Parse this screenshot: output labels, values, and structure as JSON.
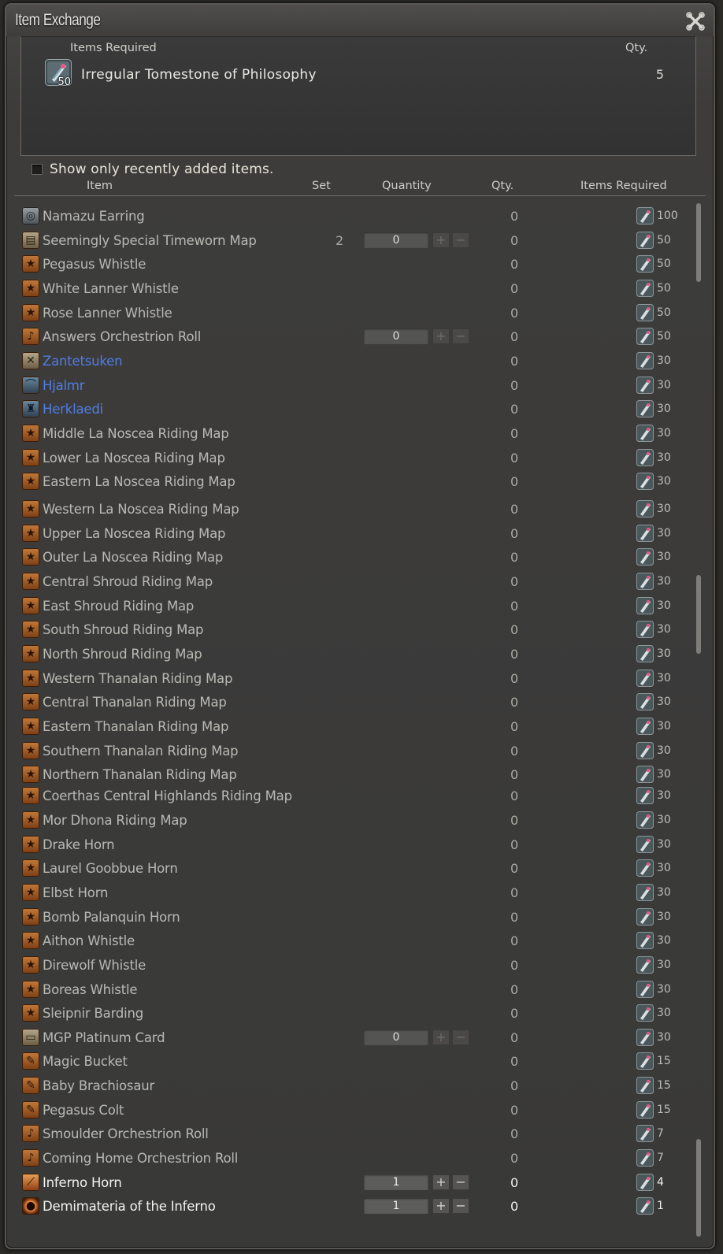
{
  "window": {
    "title": "Item Exchange"
  },
  "required_panel": {
    "header_item": "Items Required",
    "header_qty": "Qty.",
    "item_name": "Irregular Tomestone of Philosophy",
    "item_count_badge": "50",
    "item_qty": "5"
  },
  "filter": {
    "label": "Show only recently added items.",
    "checked": false
  },
  "columns": {
    "item": "Item",
    "set": "Set",
    "quantity": "Quantity",
    "qty": "Qty.",
    "items_required": "Items Required"
  },
  "rows": [
    {
      "name": "Namazu Earring",
      "icon": "earring-icon",
      "style": "gray",
      "set": "",
      "stepper": "",
      "qty": "0",
      "req": "100"
    },
    {
      "name": "Seemingly Special Timeworn Map",
      "icon": "map-icon",
      "style": "tan",
      "set": "2",
      "stepper": "0",
      "qty": "0",
      "req": "50"
    },
    {
      "name": "Pegasus Whistle",
      "icon": "star-icon",
      "style": "",
      "set": "",
      "stepper": "",
      "qty": "0",
      "req": "50"
    },
    {
      "name": "White Lanner Whistle",
      "icon": "star-icon",
      "style": "",
      "set": "",
      "stepper": "",
      "qty": "0",
      "req": "50"
    },
    {
      "name": "Rose Lanner Whistle",
      "icon": "star-icon",
      "style": "",
      "set": "",
      "stepper": "",
      "qty": "0",
      "req": "50"
    },
    {
      "name": "Answers Orchestrion Roll",
      "icon": "music-note-icon",
      "style": "",
      "set": "",
      "stepper": "0",
      "qty": "0",
      "req": "50"
    },
    {
      "name": "Zantetsuken",
      "icon": "crossed-swords-icon",
      "style": "tan",
      "set": "",
      "stepper": "",
      "qty": "0",
      "req": "30",
      "link": true
    },
    {
      "name": "Hjalmr",
      "icon": "helmet-icon",
      "style": "blue",
      "set": "",
      "stepper": "",
      "qty": "0",
      "req": "30",
      "link": true
    },
    {
      "name": "Herklaedi",
      "icon": "armor-icon",
      "style": "blue",
      "set": "",
      "stepper": "",
      "qty": "0",
      "req": "30",
      "link": true
    },
    {
      "name": "Middle La Noscea Riding Map",
      "icon": "star-icon",
      "style": "",
      "set": "",
      "stepper": "",
      "qty": "0",
      "req": "30"
    },
    {
      "name": "Lower La Noscea Riding Map",
      "icon": "star-icon",
      "style": "",
      "set": "",
      "stepper": "",
      "qty": "0",
      "req": "30"
    },
    {
      "name": "Eastern La Noscea Riding Map",
      "icon": "star-icon",
      "style": "",
      "set": "",
      "stepper": "",
      "qty": "0",
      "req": "30"
    },
    {
      "name": "Western La Noscea Riding Map",
      "icon": "star-icon",
      "style": "",
      "set": "",
      "stepper": "",
      "qty": "0",
      "req": "30"
    },
    {
      "name": "Upper La Noscea Riding Map",
      "icon": "star-icon",
      "style": "",
      "set": "",
      "stepper": "",
      "qty": "0",
      "req": "30"
    },
    {
      "name": "Outer La Noscea Riding Map",
      "icon": "star-icon",
      "style": "",
      "set": "",
      "stepper": "",
      "qty": "0",
      "req": "30"
    },
    {
      "name": "Central Shroud Riding Map",
      "icon": "star-icon",
      "style": "",
      "set": "",
      "stepper": "",
      "qty": "0",
      "req": "30"
    },
    {
      "name": "East Shroud Riding Map",
      "icon": "star-icon",
      "style": "",
      "set": "",
      "stepper": "",
      "qty": "0",
      "req": "30"
    },
    {
      "name": "South Shroud Riding Map",
      "icon": "star-icon",
      "style": "",
      "set": "",
      "stepper": "",
      "qty": "0",
      "req": "30"
    },
    {
      "name": "North Shroud Riding Map",
      "icon": "star-icon",
      "style": "",
      "set": "",
      "stepper": "",
      "qty": "0",
      "req": "30"
    },
    {
      "name": "Western Thanalan Riding Map",
      "icon": "star-icon",
      "style": "",
      "set": "",
      "stepper": "",
      "qty": "0",
      "req": "30"
    },
    {
      "name": "Central Thanalan Riding Map",
      "icon": "star-icon",
      "style": "",
      "set": "",
      "stepper": "",
      "qty": "0",
      "req": "30"
    },
    {
      "name": "Eastern Thanalan Riding Map",
      "icon": "star-icon",
      "style": "",
      "set": "",
      "stepper": "",
      "qty": "0",
      "req": "30"
    },
    {
      "name": "Southern Thanalan Riding Map",
      "icon": "star-icon",
      "style": "",
      "set": "",
      "stepper": "",
      "qty": "0",
      "req": "30"
    },
    {
      "name": "Northern Thanalan Riding Map",
      "icon": "star-icon",
      "style": "",
      "set": "",
      "stepper": "",
      "qty": "0",
      "req": "30"
    },
    {
      "name": "Coerthas Central Highlands Riding Map",
      "icon": "star-icon",
      "style": "",
      "set": "",
      "stepper": "",
      "qty": "0",
      "req": "30"
    },
    {
      "name": "Mor Dhona Riding Map",
      "icon": "star-icon",
      "style": "",
      "set": "",
      "stepper": "",
      "qty": "0",
      "req": "30"
    },
    {
      "name": "Drake Horn",
      "icon": "star-icon",
      "style": "",
      "set": "",
      "stepper": "",
      "qty": "0",
      "req": "30"
    },
    {
      "name": "Laurel Goobbue Horn",
      "icon": "star-icon",
      "style": "",
      "set": "",
      "stepper": "",
      "qty": "0",
      "req": "30"
    },
    {
      "name": "Elbst Horn",
      "icon": "star-icon",
      "style": "",
      "set": "",
      "stepper": "",
      "qty": "0",
      "req": "30"
    },
    {
      "name": "Bomb Palanquin Horn",
      "icon": "star-icon",
      "style": "",
      "set": "",
      "stepper": "",
      "qty": "0",
      "req": "30"
    },
    {
      "name": "Aithon Whistle",
      "icon": "star-icon",
      "style": "",
      "set": "",
      "stepper": "",
      "qty": "0",
      "req": "30"
    },
    {
      "name": "Direwolf Whistle",
      "icon": "star-icon",
      "style": "",
      "set": "",
      "stepper": "",
      "qty": "0",
      "req": "30"
    },
    {
      "name": "Boreas Whistle",
      "icon": "star-icon",
      "style": "",
      "set": "",
      "stepper": "",
      "qty": "0",
      "req": "30"
    },
    {
      "name": "Sleipnir Barding",
      "icon": "star-icon",
      "style": "",
      "set": "",
      "stepper": "",
      "qty": "0",
      "req": "30"
    },
    {
      "name": "MGP Platinum Card",
      "icon": "card-icon",
      "style": "tan",
      "set": "",
      "stepper": "0",
      "qty": "0",
      "req": "30"
    },
    {
      "name": "Magic Bucket",
      "icon": "minion-icon",
      "style": "",
      "set": "",
      "stepper": "",
      "qty": "0",
      "req": "15"
    },
    {
      "name": "Baby Brachiosaur",
      "icon": "minion-icon",
      "style": "",
      "set": "",
      "stepper": "",
      "qty": "0",
      "req": "15"
    },
    {
      "name": "Pegasus Colt",
      "icon": "minion-icon",
      "style": "",
      "set": "",
      "stepper": "",
      "qty": "0",
      "req": "15"
    },
    {
      "name": "Smoulder Orchestrion Roll",
      "icon": "music-note-icon",
      "style": "",
      "set": "",
      "stepper": "",
      "qty": "0",
      "req": "7"
    },
    {
      "name": "Coming Home Orchestrion Roll",
      "icon": "music-note-icon",
      "style": "",
      "set": "",
      "stepper": "",
      "qty": "0",
      "req": "7"
    },
    {
      "name": "Inferno Horn",
      "icon": "horn-icon",
      "style": "fire",
      "set": "",
      "stepper": "1",
      "qty": "0",
      "req": "4",
      "bright": true
    },
    {
      "name": "Demimateria of the Inferno",
      "icon": "materia-orb-icon",
      "style": "dark",
      "set": "",
      "stepper": "1",
      "qty": "0",
      "req": "1",
      "bright": true
    }
  ],
  "glyphs": {
    "plus": "+",
    "minus": "−"
  },
  "colors": {
    "link": "#4f7de3",
    "accent_orange": "#c27a3a"
  }
}
